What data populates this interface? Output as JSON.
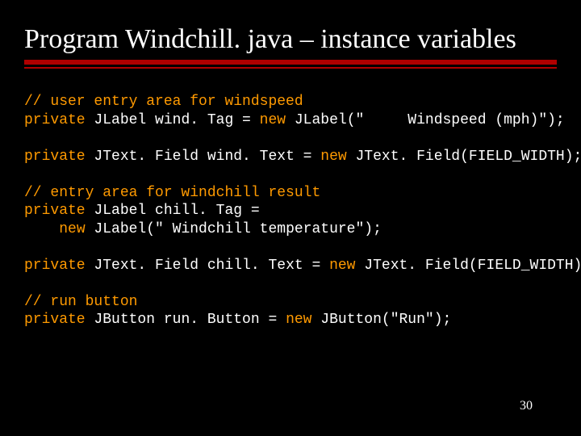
{
  "title": "Program Windchill. java – instance variables",
  "code": {
    "c1": "// user entry area for windspeed",
    "l1a": "private",
    "l1b": " JLabel wind. Tag = ",
    "l1c": "new",
    "l1d": " JLabel(\"     Windspeed (mph)\");",
    "l2a": "private",
    "l2b": " JText. Field wind. Text = ",
    "l2c": "new",
    "l2d": " JText. Field(FIELD_WIDTH);",
    "c2": "// entry area for windchill result",
    "l3a": "private",
    "l3b": " JLabel chill. Tag =",
    "l3ind": "    ",
    "l3c": "new",
    "l3d": " JLabel(\" Windchill temperature\");",
    "l4a": "private",
    "l4b": " JText. Field chill. Text = ",
    "l4c": "new",
    "l4d": " JText. Field(FIELD_WIDTH);",
    "c3": "// run button",
    "l5a": "private",
    "l5b": " JButton run. Button = ",
    "l5c": "new",
    "l5d": " JButton(\"Run\");"
  },
  "pageNumber": "30"
}
